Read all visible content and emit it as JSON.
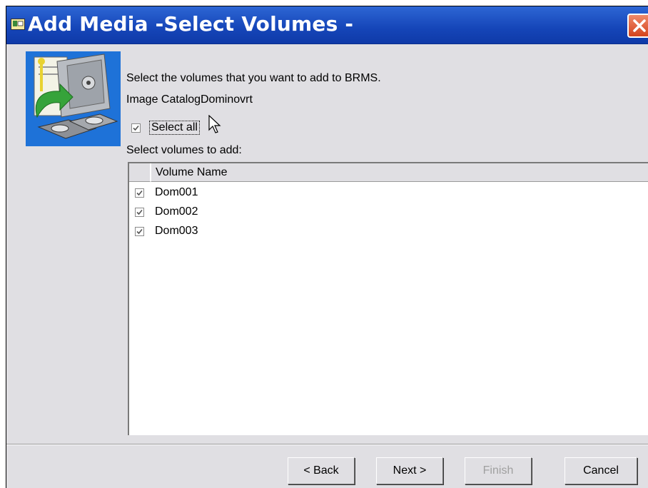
{
  "window": {
    "title": "Add Media -Select Volumes -"
  },
  "intro": {
    "instruction": "Select the volumes that you want to add to BRMS.",
    "catalog_label": "Image Catalog:",
    "catalog_value": "Dominovrt"
  },
  "select_all": {
    "label": "Select all",
    "checked": true
  },
  "volumes_label": "Select volumes to add:",
  "table": {
    "columns": [
      "Volume Name"
    ],
    "rows": [
      {
        "name": "Dom001",
        "checked": true
      },
      {
        "name": "Dom002",
        "checked": true
      },
      {
        "name": "Dom003",
        "checked": true
      }
    ]
  },
  "buttons": {
    "back": "< Back",
    "next": "Next >",
    "finish": "Finish",
    "cancel": "Cancel"
  },
  "colors": {
    "titlebar": "#1545b8",
    "dialog_bg": "#e0dfe3",
    "close": "#d4431d",
    "wizard_bg": "#1e72d8"
  }
}
